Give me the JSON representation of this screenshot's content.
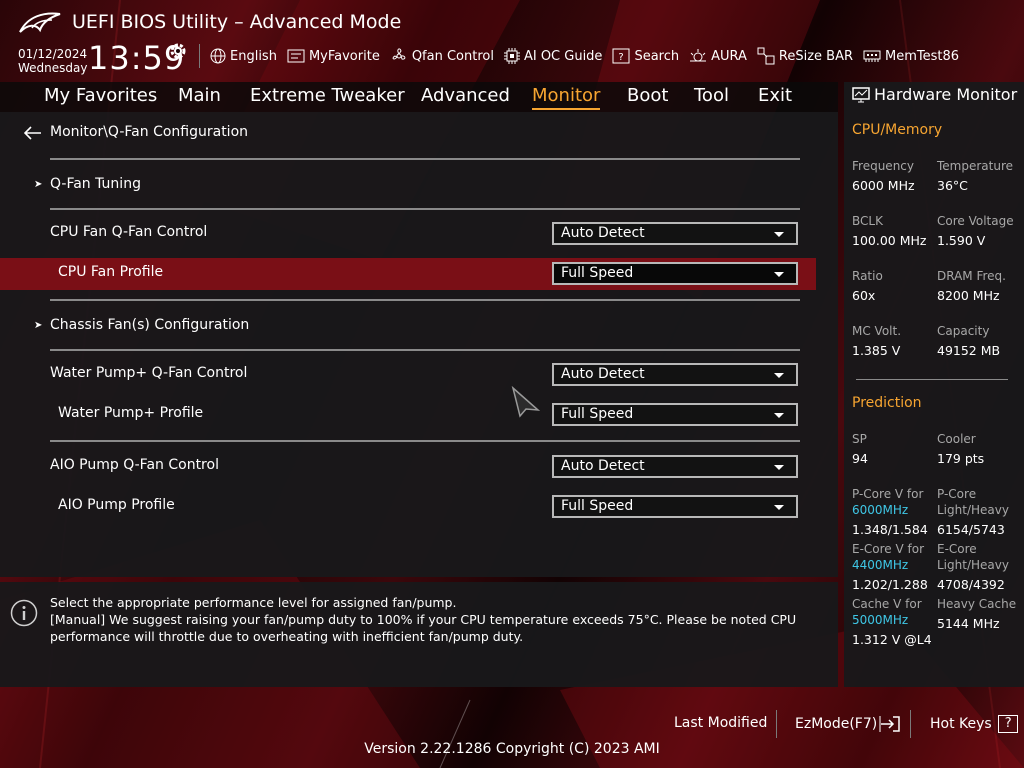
{
  "header": {
    "title": "UEFI BIOS Utility – Advanced Mode",
    "date": "01/12/2024",
    "weekday": "Wednesday",
    "time": "13:59",
    "tools": [
      {
        "label": "English",
        "icon": "globe-icon"
      },
      {
        "label": "MyFavorite",
        "icon": "favorite-icon"
      },
      {
        "label": "Qfan Control",
        "icon": "fan-icon"
      },
      {
        "label": "AI OC Guide",
        "icon": "chip-icon"
      },
      {
        "label": "Search",
        "icon": "search-icon"
      },
      {
        "label": "AURA",
        "icon": "aura-icon"
      },
      {
        "label": "ReSize BAR",
        "icon": "resize-bar-icon"
      },
      {
        "label": "MemTest86",
        "icon": "memory-icon"
      }
    ]
  },
  "tabs": [
    "My Favorites",
    "Main",
    "Extreme Tweaker",
    "Advanced",
    "Monitor",
    "Boot",
    "Tool",
    "Exit"
  ],
  "active_tab": "Monitor",
  "main": {
    "breadcrumb": "Monitor\\Q-Fan Configuration",
    "sections": {
      "qfan_tuning": "Q-Fan Tuning",
      "chassis": "Chassis Fan(s) Configuration"
    },
    "rows": [
      {
        "label": "CPU Fan Q-Fan Control",
        "value": "Auto Detect"
      },
      {
        "label": "CPU Fan Profile",
        "value": "Full Speed"
      },
      {
        "label": "Water Pump+ Q-Fan Control",
        "value": "Auto Detect"
      },
      {
        "label": "Water Pump+ Profile",
        "value": "Full Speed"
      },
      {
        "label": "AIO Pump Q-Fan Control",
        "value": "Auto Detect"
      },
      {
        "label": "AIO Pump Profile",
        "value": "Full Speed"
      }
    ]
  },
  "info": {
    "line1": "Select the appropriate performance level for assigned fan/pump.",
    "line2": "[Manual] We suggest raising your fan/pump duty to 100% if your CPU temperature exceeds 75°C. Please be noted CPU performance will throttle due to overheating with inefficient fan/pump duty."
  },
  "hardware_monitor": {
    "title": "Hardware Monitor",
    "cpu_memory_title": "CPU/Memory",
    "cpu": [
      {
        "label": "Frequency",
        "value": "6000 MHz"
      },
      {
        "label": "Temperature",
        "value": "36°C"
      },
      {
        "label": "BCLK",
        "value": "100.00 MHz"
      },
      {
        "label": "Core Voltage",
        "value": "1.590 V"
      },
      {
        "label": "Ratio",
        "value": "60x"
      },
      {
        "label": "DRAM Freq.",
        "value": "8200 MHz"
      },
      {
        "label": "MC Volt.",
        "value": "1.385 V"
      },
      {
        "label": "Capacity",
        "value": "49152 MB"
      }
    ],
    "prediction_title": "Prediction",
    "sp_label": "SP",
    "sp_value": "94",
    "cooler_label": "Cooler",
    "cooler_value": "179 pts",
    "pcore_v_label": "P-Core V for",
    "pcore_v_freq": "6000MHz",
    "pcore_v_value": "1.348/1.584",
    "pcore_lh_label1": "P-Core",
    "pcore_lh_label2": "Light/Heavy",
    "pcore_lh_value": "6154/5743",
    "ecore_v_label": "E-Core V for",
    "ecore_v_freq": "4400MHz",
    "ecore_v_value": "1.202/1.288",
    "ecore_lh_label1": "E-Core",
    "ecore_lh_label2": "Light/Heavy",
    "ecore_lh_value": "4708/4392",
    "cache_v_label": "Cache V for",
    "cache_v_freq": "5000MHz",
    "cache_v_value": "1.312 V @L4",
    "heavy_cache_label": "Heavy Cache",
    "heavy_cache_value": "5144 MHz"
  },
  "footer": {
    "last_modified": "Last Modified",
    "ezmode": "EzMode(F7)",
    "hotkeys": "Hot Keys",
    "hotkeys_key": "?",
    "version": "Version 2.22.1286 Copyright (C) 2023 AMI"
  },
  "colors": {
    "accent": "#f7a531",
    "highlight": "#7a0f16",
    "cyan": "#3fc7e6"
  }
}
